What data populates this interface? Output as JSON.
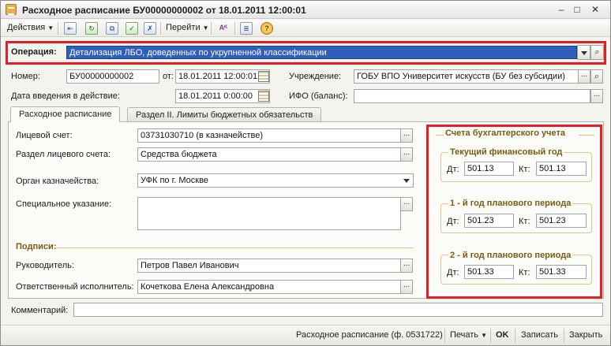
{
  "window": {
    "title": "Расходное расписание БУ00000000002 от 18.01.2011 12:00:01",
    "minimize": "–",
    "maximize": "□",
    "close": "✕"
  },
  "toolbar": {
    "actions_label": "Действия",
    "goto_label": "Перейти",
    "help_label": "?"
  },
  "operation": {
    "label": "Операция:",
    "value": "Детализация ЛБО, доведенных по укрупненной классификации"
  },
  "header": {
    "number_label": "Номер:",
    "number_value": "БУ00000000002",
    "from_label": "от:",
    "date_value": "18.01.2011 12:00:01",
    "institution_label": "Учреждение:",
    "institution_value": "ГОБУ ВПО Университет искусств (БУ без субсидии)",
    "effective_label": "Дата введения в действие:",
    "effective_value": "18.01.2011 0:00:00",
    "ifo_label": "ИФО (баланс):",
    "ifo_value": ""
  },
  "tabs": [
    {
      "label": "Расходное расписание"
    },
    {
      "label": "Раздел II. Лимиты бюджетных обязательств"
    }
  ],
  "form": {
    "account_label": "Лицевой счет:",
    "account_value": "03731030710 (в казначействе)",
    "section_label": "Раздел лицевого счета:",
    "section_value": "Средства бюджета",
    "treasury_label": "Орган казначейства:",
    "treasury_value": "УФК по г. Москве",
    "special_label": "Специальное указание:",
    "special_value": "",
    "signatures_title": "Подписи:",
    "head_label": "Руководитель:",
    "head_value": "Петров Павел Иванович",
    "executor_label": "Ответственный исполнитель:",
    "executor_value": "Кочеткова Елена Александровна"
  },
  "accounts": {
    "title": "Счета бухгалтерского учета",
    "groups": [
      {
        "title": "Текущий финансовый год",
        "dt_label": "Дт:",
        "dt_value": "501.13",
        "kt_label": "Кт:",
        "kt_value": "501.13"
      },
      {
        "title": "1 - й год планового периода",
        "dt_label": "Дт:",
        "dt_value": "501.23",
        "kt_label": "Кт:",
        "kt_value": "501.23"
      },
      {
        "title": "2 - й год планового периода",
        "dt_label": "Дт:",
        "dt_value": "501.33",
        "kt_label": "Кт:",
        "kt_value": "501.33"
      }
    ]
  },
  "comment": {
    "label": "Комментарий:",
    "value": ""
  },
  "footer": {
    "print_form": "Расходное расписание (ф. 0531722)",
    "print": "Печать",
    "ok": "OK",
    "save": "Записать",
    "close": "Закрыть"
  },
  "colors": {
    "highlight_frame": "#e41e26",
    "operation_selection": "#2e5fb9",
    "section_title": "#7a5a10"
  }
}
